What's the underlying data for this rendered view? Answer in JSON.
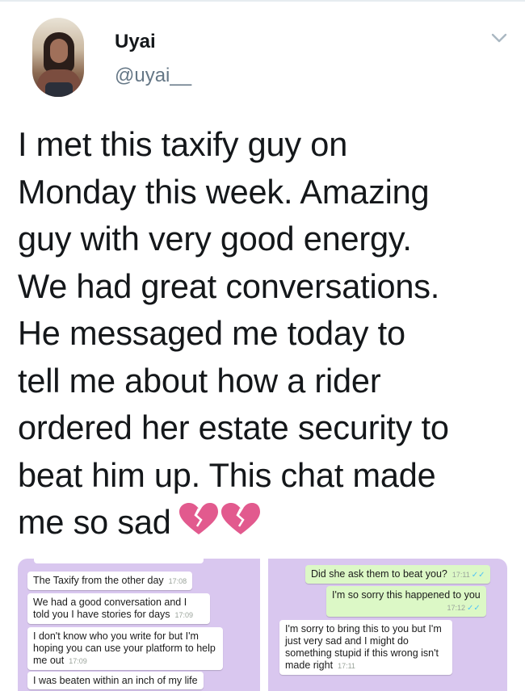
{
  "user": {
    "display_name": "Uyai",
    "handle": "@uyai__"
  },
  "tweet": {
    "lines": [
      "I met this taxify guy on",
      "Monday this week. Amazing",
      "guy with very good energy.",
      "We had great conversations.",
      "He messaged me today to",
      "tell me about how a rider",
      "ordered her estate security to",
      "beat him up. This chat made",
      "me so sad"
    ],
    "emoji": "broken-heart-icon"
  },
  "screenshots": {
    "left": {
      "messages": [
        {
          "text": "The Taxify from the other day",
          "time": "17:08"
        },
        {
          "text": "We had a good conversation and I told you I have stories for days",
          "time": "17:09"
        },
        {
          "text": "I don't know who you write for but I'm hoping you can use your platform to help me out",
          "time": "17:09"
        },
        {
          "text": "I was beaten within an inch of my life",
          "time": ""
        }
      ]
    },
    "right": {
      "messages": [
        {
          "text": "Did she ask them to beat you?",
          "time": "17:11"
        },
        {
          "text": "I'm so sorry this happened to you",
          "time": "17:12"
        },
        {
          "text": "I'm sorry to bring this to you but I'm just very sad and I might do something stupid if this wrong isn't made right",
          "time": "17:11"
        }
      ]
    }
  },
  "colors": {
    "chat_background": "#d9c7ef",
    "outgoing_bubble": "#dcf8c6",
    "read_ticks": "#4fc3f7",
    "heart": "#e25a8e"
  }
}
